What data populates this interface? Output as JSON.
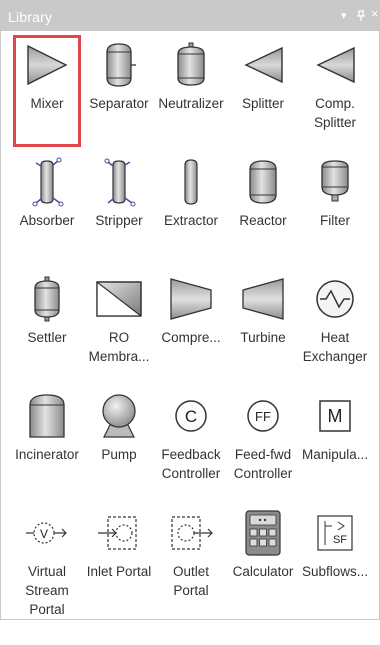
{
  "panel": {
    "title": "Library",
    "controls": {
      "dropdown": "▾",
      "pin": "ᵖ",
      "close": "×"
    }
  },
  "items": [
    {
      "label": "Mixer",
      "icon": "mixer-icon",
      "selected": true
    },
    {
      "label": "Separator",
      "icon": "separator-icon"
    },
    {
      "label": "Neutralizer",
      "icon": "neutralizer-icon"
    },
    {
      "label": "Splitter",
      "icon": "splitter-icon"
    },
    {
      "label": "Comp.\nSplitter",
      "icon": "comp-splitter-icon"
    },
    {
      "label": "Absorber",
      "icon": "absorber-icon"
    },
    {
      "label": "Stripper",
      "icon": "stripper-icon"
    },
    {
      "label": "Extractor",
      "icon": "extractor-icon"
    },
    {
      "label": "Reactor",
      "icon": "reactor-icon"
    },
    {
      "label": "Filter",
      "icon": "filter-icon"
    },
    {
      "label": "Settler",
      "icon": "settler-icon"
    },
    {
      "label": "RO\nMembra...",
      "icon": "ro-membrane-icon"
    },
    {
      "label": "Compre...",
      "icon": "compressor-icon"
    },
    {
      "label": "Turbine",
      "icon": "turbine-icon"
    },
    {
      "label": "Heat\nExchanger",
      "icon": "heat-exchanger-icon"
    },
    {
      "label": "Incinerator",
      "icon": "incinerator-icon"
    },
    {
      "label": "Pump",
      "icon": "pump-icon"
    },
    {
      "label": "Feedback\nController",
      "icon": "feedback-controller-icon"
    },
    {
      "label": "Feed-fwd\nController",
      "icon": "feedforward-controller-icon"
    },
    {
      "label": "Manipula...",
      "icon": "manipulator-icon"
    },
    {
      "label": "Virtual\nStream\nPortal",
      "icon": "virtual-stream-portal-icon"
    },
    {
      "label": "Inlet Portal",
      "icon": "inlet-portal-icon"
    },
    {
      "label": "Outlet\nPortal",
      "icon": "outlet-portal-icon"
    },
    {
      "label": "Calculator",
      "icon": "calculator-icon"
    },
    {
      "label": "Subflows...",
      "icon": "subflows-icon"
    }
  ],
  "icon_text": {
    "feedback": "C",
    "feedforward": "FF",
    "manipulator": "M",
    "subflows": "SF",
    "virtual_stream": "V"
  },
  "colors": {
    "titlebar": "#c9c9c9",
    "selection": "#e0474a",
    "label": "#333333"
  }
}
